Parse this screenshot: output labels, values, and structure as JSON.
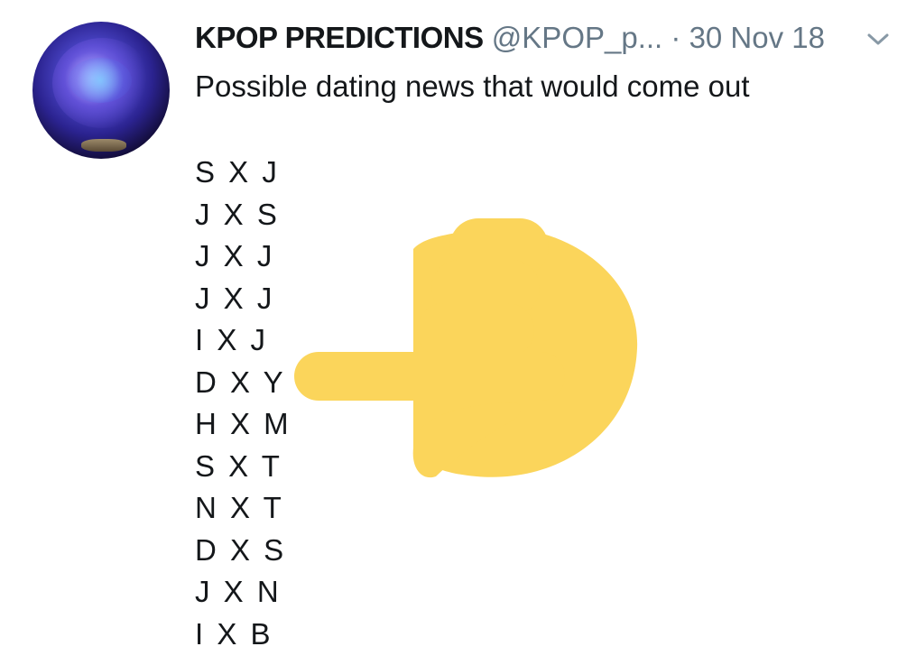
{
  "tweet": {
    "author_name": "KPOP PREDICTIONS",
    "handle": "@KPOP_p...",
    "separator": "·",
    "date": "30 Nov 18",
    "text": "Possible dating news that would come out",
    "pairs": [
      "S X J",
      "J X S",
      "J X J",
      "J X J",
      "I X J",
      "D X Y",
      "H X M",
      "S X T",
      "N X T",
      "D X S",
      "J X N",
      "I X B"
    ]
  },
  "icons": {
    "menu": "chevron-down-icon",
    "emoji": "backhand-index-pointing-left-emoji"
  },
  "colors": {
    "text": "#14171a",
    "secondary": "#657786",
    "emoji_yellow": "#fbd55b"
  }
}
